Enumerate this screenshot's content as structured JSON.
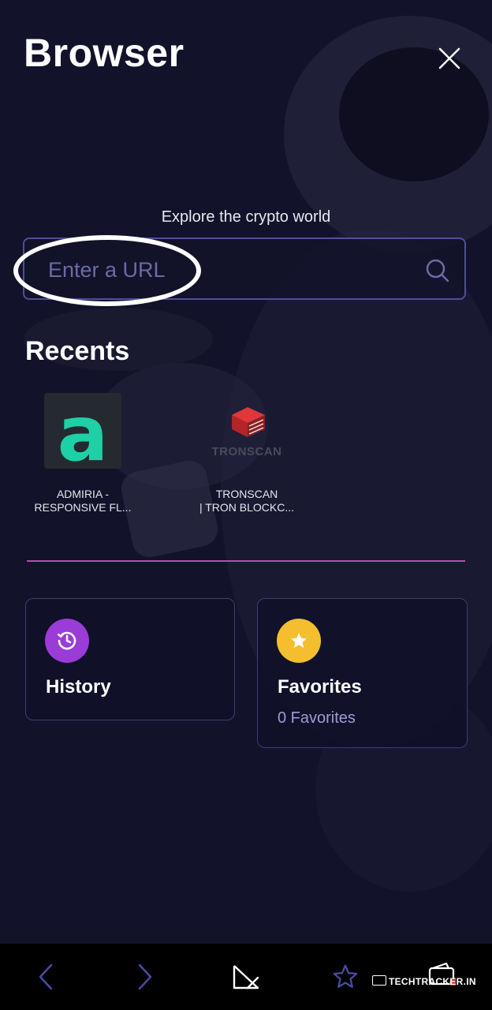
{
  "header": {
    "title": "Browser"
  },
  "hero": {
    "tagline": "Explore the crypto world"
  },
  "search": {
    "placeholder": "Enter a URL",
    "value": ""
  },
  "recents": {
    "title": "Recents",
    "items": [
      {
        "label": "ADMIRIA -\nRESPONSIVE FL...",
        "icon": "admiria-logo",
        "logo_text": "a"
      },
      {
        "label": "TRONSCAN\n| TRON BLOCKC...",
        "icon": "tronscan-logo",
        "logo_text": "TRONSCAN"
      }
    ]
  },
  "cards": {
    "history": {
      "title": "History",
      "icon": "history-clock-icon",
      "color": "#9b3bd8"
    },
    "favorites": {
      "title": "Favorites",
      "subtitle": "0 Favorites",
      "icon": "star-icon",
      "color": "#f4be2e"
    }
  },
  "watermark": {
    "text": "TECHTRACKER.IN"
  },
  "colors": {
    "background": "#12122a",
    "accent_border": "#4f4f9c",
    "divider": "#b84fa8",
    "bottom_bar": "#000000"
  }
}
